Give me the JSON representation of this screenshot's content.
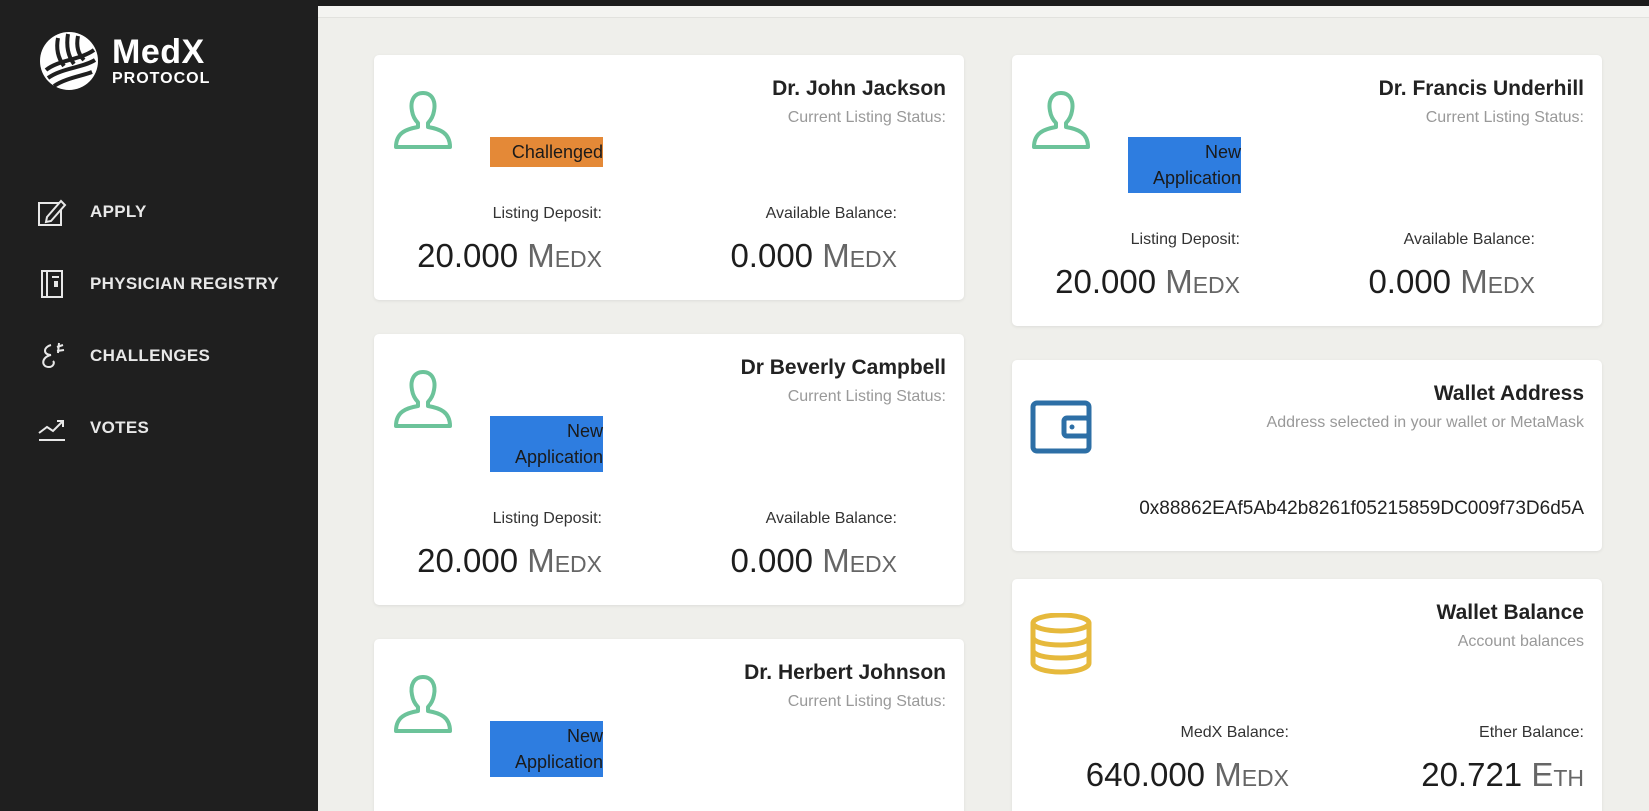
{
  "brand": {
    "name": "MedX",
    "sub": "PROTOCOL"
  },
  "nav": [
    {
      "label": "APPLY",
      "icon": "edit-icon"
    },
    {
      "label": "PHYSICIAN REGISTRY",
      "icon": "registry-book-icon"
    },
    {
      "label": "CHALLENGES",
      "icon": "challenge-glyph-icon"
    },
    {
      "label": "VOTES",
      "icon": "trend-chart-icon"
    }
  ],
  "listings": [
    {
      "name": "Dr. John Jackson",
      "status_label": "Current Listing Status:",
      "status": "Challenged",
      "deposit_label": "Listing Deposit:",
      "deposit_value": "20.000",
      "deposit_unit": "Medx",
      "balance_label": "Available Balance:",
      "balance_value": "0.000",
      "balance_unit": "Medx"
    },
    {
      "name": "Dr. Francis Underhill",
      "status_label": "Current Listing Status:",
      "status": "New Application",
      "deposit_label": "Listing Deposit:",
      "deposit_value": "20.000",
      "deposit_unit": "Medx",
      "balance_label": "Available Balance:",
      "balance_value": "0.000",
      "balance_unit": "Medx"
    },
    {
      "name": "Dr Beverly Campbell",
      "status_label": "Current Listing Status:",
      "status": "New Application",
      "deposit_label": "Listing Deposit:",
      "deposit_value": "20.000",
      "deposit_unit": "Medx",
      "balance_label": "Available Balance:",
      "balance_value": "0.000",
      "balance_unit": "Medx"
    },
    {
      "name": "Dr. Herbert Johnson",
      "status_label": "Current Listing Status:",
      "status": "New Application"
    }
  ],
  "wallet_address": {
    "title": "Wallet Address",
    "subtitle": "Address selected in your wallet or MetaMask",
    "address": "0x88862EAf5Ab42b8261f05215859DC009f73D6d5A"
  },
  "wallet_balance": {
    "title": "Wallet Balance",
    "subtitle": "Account balances",
    "medx_label": "MedX Balance:",
    "medx_value": "640.000",
    "medx_unit": "Medx",
    "ether_label": "Ether Balance:",
    "ether_value": "20.721",
    "ether_unit": "Eth"
  },
  "colors": {
    "sidebar_bg": "#1f1f1f",
    "main_bg": "#efefeb",
    "avatar_green": "#6cc39a",
    "challenged": "#e48937",
    "new_application": "#2e7de0",
    "wallet_blue": "#2d6fa6",
    "coins_gold": "#e6b93c"
  }
}
